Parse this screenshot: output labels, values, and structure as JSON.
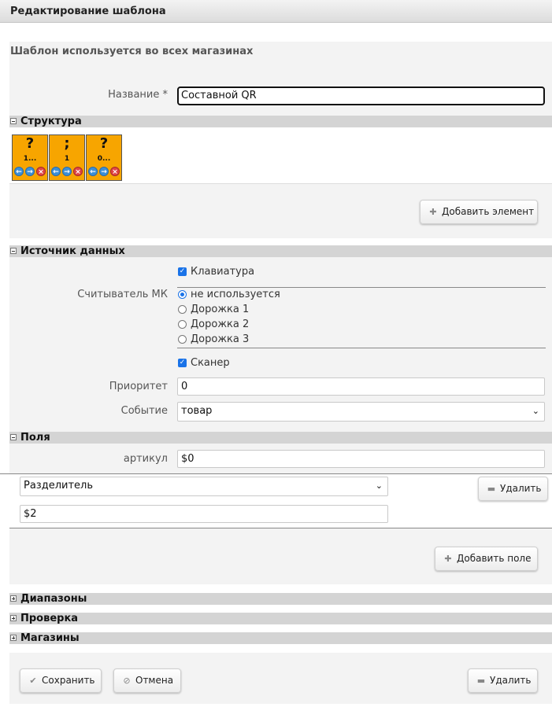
{
  "window": {
    "title": "Редактирование шаблона"
  },
  "info": {
    "shops_note": "Шаблон используется во всех магазинах"
  },
  "name_field": {
    "label": "Название *",
    "value": "Составной QR"
  },
  "structure": {
    "title": "Структура",
    "tiles": [
      {
        "symbol": "?",
        "count": "1..."
      },
      {
        "symbol": ";",
        "count": "1"
      },
      {
        "symbol": "?",
        "count": "0..."
      }
    ],
    "add_label": "Добавить элемент"
  },
  "datasource": {
    "title": "Источник данных",
    "keyboard_label": "Клавиатура",
    "keyboard_checked": true,
    "mk_label": "Считыватель МК",
    "mk_options": [
      "не используется",
      "Дорожка 1",
      "Дорожка 2",
      "Дорожка 3"
    ],
    "mk_selected": "не используется",
    "scanner_label": "Сканер",
    "scanner_checked": true,
    "priority_label": "Приоритет",
    "priority_value": "0",
    "event_label": "Событие",
    "event_value": "товар"
  },
  "fields": {
    "title": "Поля",
    "article_label": "артикул",
    "article_value": "$0",
    "separator_value": "Разделитель",
    "separator_param": "$2",
    "remove_label": "Удалить",
    "add_label": "Добавить поле"
  },
  "collapsed_sections": [
    "Диапазоны",
    "Проверка",
    "Магазины"
  ],
  "footer": {
    "save_label": "Сохранить",
    "cancel_label": "Отмена",
    "delete_label": "Удалить"
  },
  "colors": {
    "tile": "#f7a500",
    "section_header": "#d4d4d4",
    "panel": "#f3f3f3",
    "accent": "#1a73e8"
  },
  "icons": {
    "arrow_left": "arrow-left-icon",
    "arrow_right": "arrow-right-icon",
    "delete": "delete-x-icon",
    "plus": "plus-icon",
    "minus": "minus-icon",
    "check": "check-icon",
    "cancel": "cancel-icon"
  }
}
